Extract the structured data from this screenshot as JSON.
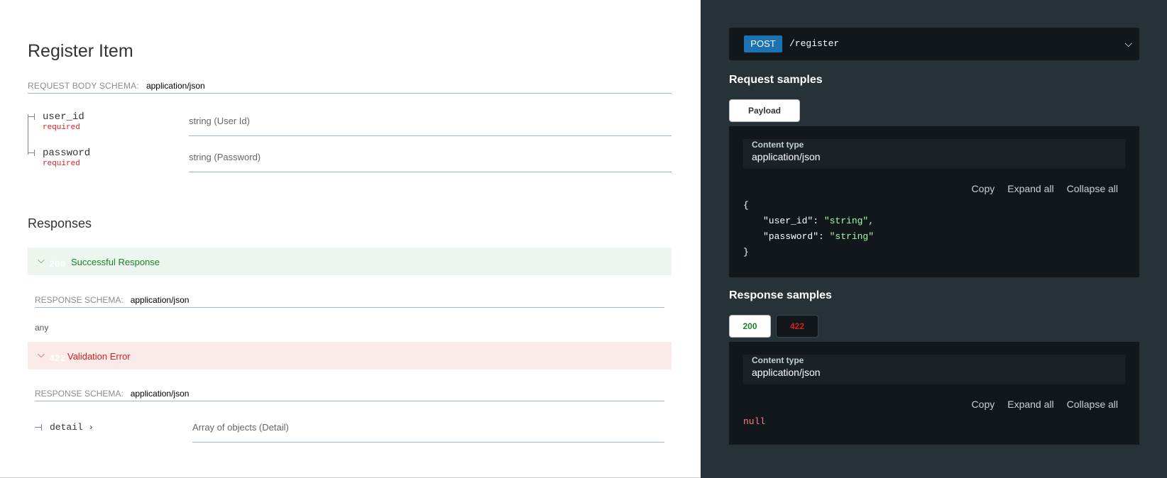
{
  "operation": {
    "title": "Register Item",
    "request_schema_label": "REQUEST BODY SCHEMA:",
    "request_schema_type": "application/json",
    "properties": [
      {
        "name": "user_id",
        "required": "required",
        "type": "string (User Id)"
      },
      {
        "name": "password",
        "required": "required",
        "type": "string (Password)"
      }
    ]
  },
  "responses": {
    "title": "Responses",
    "ok": {
      "code": "200",
      "label": "Successful Response",
      "schema_label": "RESPONSE SCHEMA:",
      "schema_type": "application/json",
      "body": "any"
    },
    "err": {
      "code": "422",
      "label": "Validation Error",
      "schema_label": "RESPONSE SCHEMA:",
      "schema_type": "application/json",
      "field": "detail",
      "field_type": "Array of objects (Detail)"
    }
  },
  "panel": {
    "method": "POST",
    "path": "/register",
    "request_samples_title": "Request samples",
    "payload_tab": "Payload",
    "content_type_label": "Content type",
    "content_type_value": "application/json",
    "copy": "Copy",
    "expand_all": "Expand all",
    "collapse_all": "Collapse all",
    "request_json": {
      "open": "{",
      "close": "}",
      "line1_key": "\"user_id\"",
      "line1_val": "\"string\",",
      "line2_key": "\"password\"",
      "line2_val": "\"string\""
    },
    "response_samples_title": "Response samples",
    "tab_200": "200",
    "tab_422": "422",
    "response_null": "null"
  },
  "colors": {
    "ok": "#1d8127",
    "err": "#d41f1c",
    "method_bg": "#1a72b2",
    "panel_bg": "#263238"
  }
}
